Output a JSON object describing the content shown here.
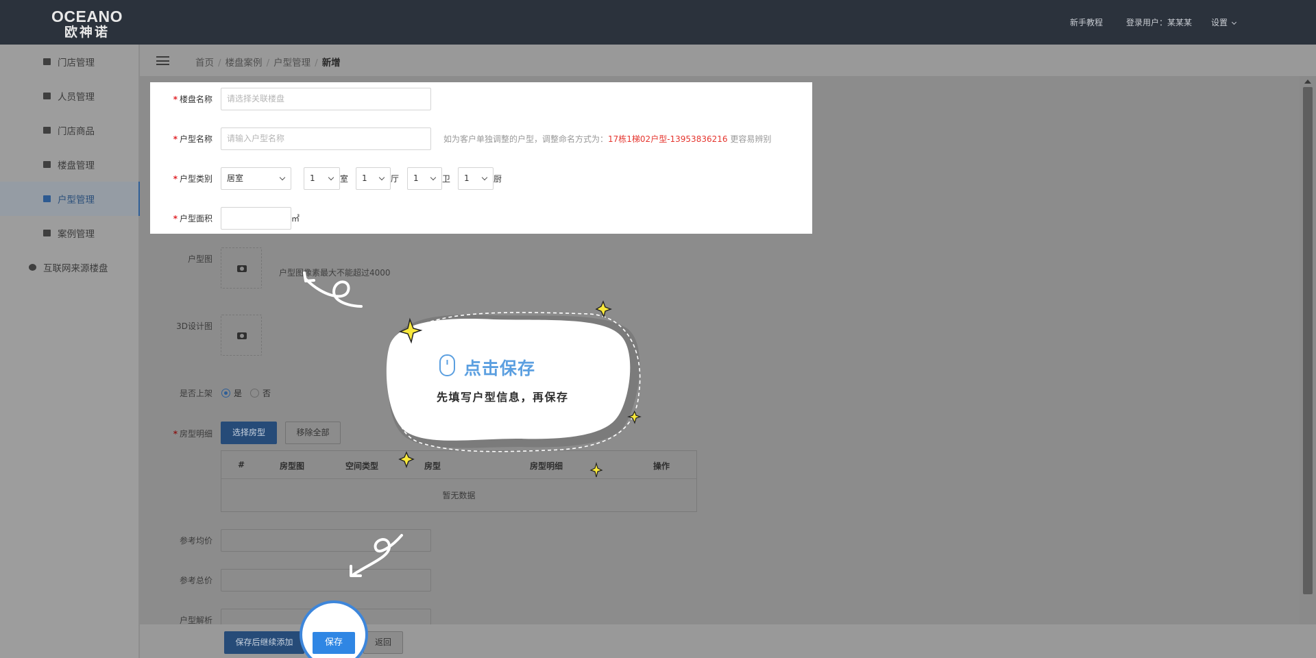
{
  "header": {
    "logo_en": "OCEANO",
    "logo_cn": "欧神诺",
    "nav": [
      "新手教程",
      "登录用户：某某某",
      "设置"
    ]
  },
  "sidebar": {
    "items": [
      {
        "label": "门店管理",
        "icon": "home-icon"
      },
      {
        "label": "人员管理",
        "icon": "user-icon"
      },
      {
        "label": "门店商品",
        "icon": "goods-icon"
      },
      {
        "label": "楼盘管理",
        "icon": "building-icon"
      },
      {
        "label": "户型管理",
        "icon": "floorplan-icon",
        "active": true
      },
      {
        "label": "案例管理",
        "icon": "case-icon"
      },
      {
        "label": "互联网来源楼盘",
        "icon": "globe-icon"
      }
    ]
  },
  "breadcrumb": [
    "首页",
    "楼盘案例",
    "户型管理",
    "新增"
  ],
  "form": {
    "estate_name": {
      "label": "楼盘名称",
      "placeholder": "请选择关联楼盘"
    },
    "layout_name": {
      "label": "户型名称",
      "placeholder": "请输入户型名称",
      "hint_prefix": "如为客户单独调整的户型，调整命名方式为：",
      "hint_example": "17栋1梯02户型-13953836216",
      "hint_suffix": " 更容易辨别"
    },
    "layout_type": {
      "label": "户型类别",
      "type_value": "居室",
      "rooms": {
        "value": "1",
        "unit": "室"
      },
      "halls": {
        "value": "1",
        "unit": "厅"
      },
      "baths": {
        "value": "1",
        "unit": "卫"
      },
      "kitchens": {
        "value": "1",
        "unit": "厨"
      }
    },
    "area": {
      "label": "户型面积",
      "unit": "㎡"
    },
    "floorplan_image": {
      "label": "户型图",
      "hint": "户型图像素最大不能超过4000"
    },
    "design_3d": {
      "label": "3D设计图"
    },
    "listed": {
      "label": "是否上架",
      "options": [
        "是",
        "否"
      ],
      "selected": "是"
    },
    "room_details": {
      "label": "房型明细",
      "select_button": "选择房型",
      "remove_all_button": "移除全部",
      "columns": [
        "#",
        "房型图",
        "空间类型",
        "房型",
        "房型明细",
        "操作"
      ],
      "empty_text": "暂无数据"
    },
    "ref_avg_price": {
      "label": "参考均价"
    },
    "ref_total_price": {
      "label": "参考总价"
    },
    "analysis": {
      "label": "户型解析"
    }
  },
  "footer": {
    "save_continue": "保存后继续添加",
    "save": "保存",
    "back": "返回"
  },
  "tutorial": {
    "title": "点击保存",
    "subtitle": "先填写户型信息，再保存"
  },
  "colors": {
    "header_bg": "#2b323c",
    "required_star": "#e0252a",
    "hint_red": "#e5352e",
    "tutorial_blue": "#5b9fe0",
    "save_button": "#2f86e4"
  }
}
